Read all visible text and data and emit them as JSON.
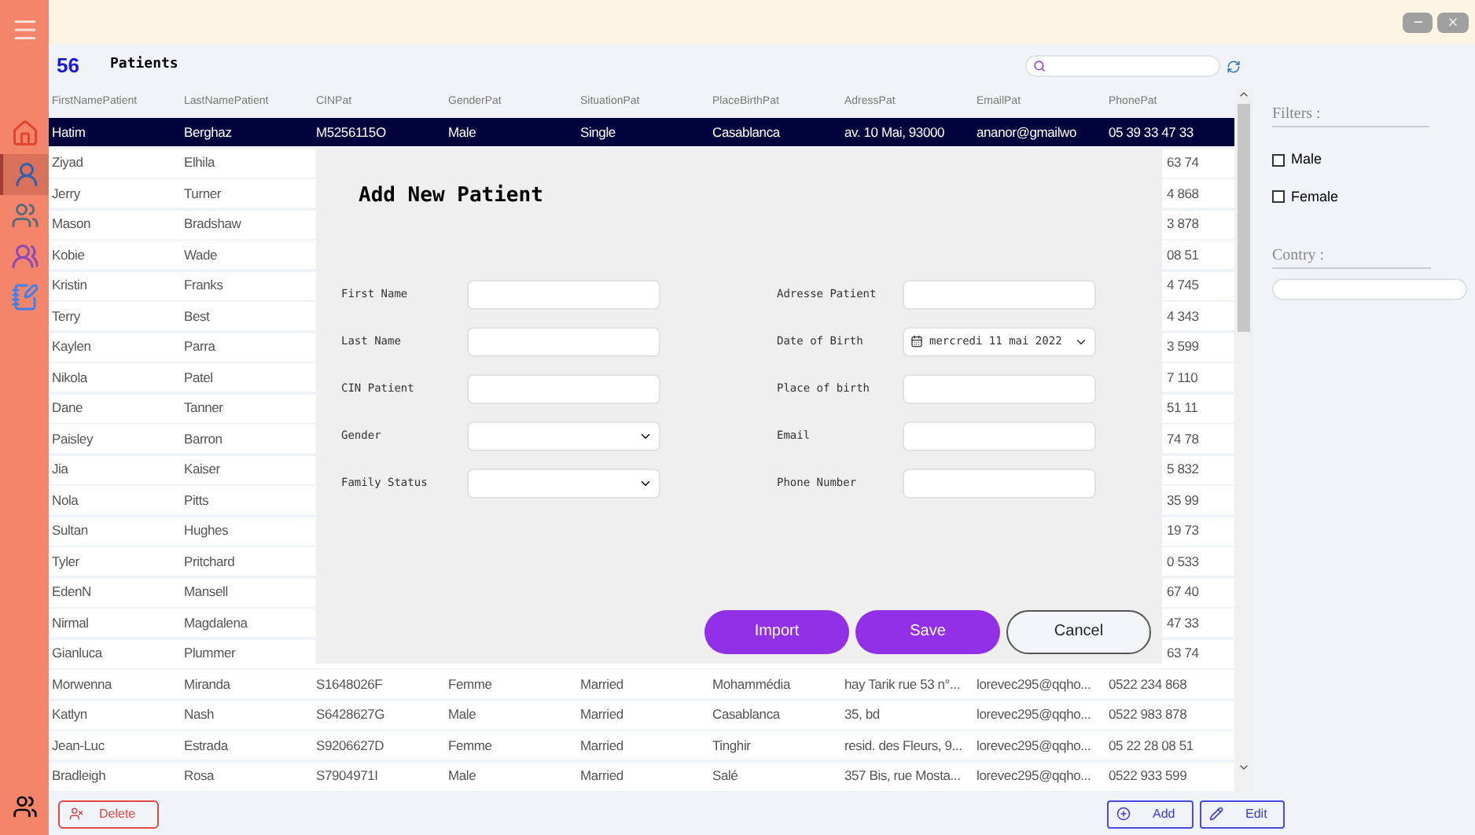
{
  "sidebar": {
    "items": [
      {
        "kind": "home",
        "selected": false
      },
      {
        "kind": "patient",
        "selected": true
      },
      {
        "kind": "group",
        "selected": false
      },
      {
        "kind": "family",
        "selected": false
      },
      {
        "kind": "notes",
        "selected": false
      }
    ]
  },
  "header": {
    "count": "56",
    "title": "Patients"
  },
  "table": {
    "columns": [
      "FirstNamePatient",
      "LastNamePatient",
      "CINPat",
      "GenderPat",
      "SituationPat",
      "PlaceBirthPat",
      "AdressPat",
      "EmailPat",
      "PhonePat"
    ],
    "rows": [
      {
        "kind": "full",
        "selected": true,
        "cells": [
          "Hatim",
          "Berghaz",
          "M5256115O",
          "Male",
          "Single",
          "Casablanca",
          "av. 10 Mai, 93000",
          "ananor@gmailwo",
          "05 39 33 47 33"
        ]
      },
      {
        "kind": "covered",
        "selected": false,
        "cells": [
          "Ziyad",
          "Elhila",
          "63 74"
        ]
      },
      {
        "kind": "covered",
        "selected": false,
        "cells": [
          "Jerry",
          "Turner",
          "4 868"
        ]
      },
      {
        "kind": "covered",
        "selected": false,
        "cells": [
          "Mason",
          "Bradshaw",
          "3 878"
        ]
      },
      {
        "kind": "covered",
        "selected": false,
        "cells": [
          "Kobie",
          "Wade",
          "08 51"
        ]
      },
      {
        "kind": "covered",
        "selected": false,
        "cells": [
          "Kristin",
          "Franks",
          "4 745"
        ]
      },
      {
        "kind": "covered",
        "selected": false,
        "cells": [
          "Terry",
          "Best",
          "4 343"
        ]
      },
      {
        "kind": "covered",
        "selected": false,
        "cells": [
          "Kaylen",
          "Parra",
          "3 599"
        ]
      },
      {
        "kind": "covered",
        "selected": false,
        "cells": [
          "Nikola",
          "Patel",
          "7 110"
        ]
      },
      {
        "kind": "covered",
        "selected": false,
        "cells": [
          "Dane",
          "Tanner",
          "51 11"
        ]
      },
      {
        "kind": "covered",
        "selected": false,
        "cells": [
          "Paisley",
          "Barron",
          "74 78"
        ]
      },
      {
        "kind": "covered",
        "selected": false,
        "cells": [
          "Jia",
          "Kaiser",
          "5 832"
        ]
      },
      {
        "kind": "covered",
        "selected": false,
        "cells": [
          "Nola",
          "Pitts",
          "35 99"
        ]
      },
      {
        "kind": "covered",
        "selected": false,
        "cells": [
          "Sultan",
          "Hughes",
          "19 73"
        ]
      },
      {
        "kind": "covered",
        "selected": false,
        "cells": [
          "Tyler",
          "Pritchard",
          "0 533"
        ]
      },
      {
        "kind": "covered",
        "selected": false,
        "cells": [
          "EdenN",
          "Mansell",
          "67 40"
        ]
      },
      {
        "kind": "covered",
        "selected": false,
        "cells": [
          "Nirmal",
          "Magdalena",
          "47 33"
        ]
      },
      {
        "kind": "covered",
        "selected": false,
        "cells": [
          "Gianluca",
          "Plummer",
          "63 74"
        ]
      },
      {
        "kind": "full",
        "selected": false,
        "cells": [
          "Morwenna",
          "Miranda",
          "S1648026F",
          "Femme",
          "Married",
          "Mohammédia",
          "hay Tarik rue 53 n°...",
          "lorevec295@qqho...",
          "0522 234 868"
        ]
      },
      {
        "kind": "full",
        "selected": false,
        "cells": [
          "Katlyn",
          "Nash",
          "S6428627G",
          "Male",
          "Married",
          "Casablanca",
          "35, bd",
          "lorevec295@qqho...",
          "0522 983 878"
        ]
      },
      {
        "kind": "full",
        "selected": false,
        "cells": [
          "Jean-Luc",
          "Estrada",
          "S9206627D",
          "Femme",
          "Married",
          "Tinghir",
          "resid. des Fleurs, 9...",
          "lorevec295@qqho...",
          "05 22 28 08 51"
        ]
      },
      {
        "kind": "full",
        "selected": false,
        "cells": [
          "Bradleigh",
          "Rosa",
          "S7904971I",
          "Male",
          "Married",
          "Salé",
          "357 Bis, rue Mosta...",
          "lorevec295@qqho...",
          "0522 933 599"
        ]
      }
    ]
  },
  "filters": {
    "title": "Filters :",
    "options": [
      {
        "label": "Male",
        "checked": false
      },
      {
        "label": "Female",
        "checked": false
      }
    ],
    "country_label": "Contry :"
  },
  "actions": {
    "delete": "Delete",
    "add": "Add",
    "edit": "Edit"
  },
  "dialog": {
    "title": "Add New Patient",
    "fields": [
      {
        "label": "First Name",
        "kind": "text"
      },
      {
        "label": "Last Name",
        "kind": "text"
      },
      {
        "label": "CIN Patient",
        "kind": "text"
      },
      {
        "label": "Gender",
        "kind": "select"
      },
      {
        "label": "Family Status",
        "kind": "select"
      },
      {
        "label": "Adresse Patient",
        "kind": "text"
      },
      {
        "label": "Date of Birth",
        "kind": "date",
        "value": "mercredi 11 mai 2022"
      },
      {
        "label": "Place of birth",
        "kind": "text"
      },
      {
        "label": "Email",
        "kind": "text"
      },
      {
        "label": "Phone Number",
        "kind": "text"
      }
    ],
    "buttons": [
      {
        "label": "Import",
        "kind": "primary"
      },
      {
        "label": "Save",
        "kind": "primary"
      },
      {
        "label": "Cancel",
        "kind": "secondary"
      }
    ]
  }
}
